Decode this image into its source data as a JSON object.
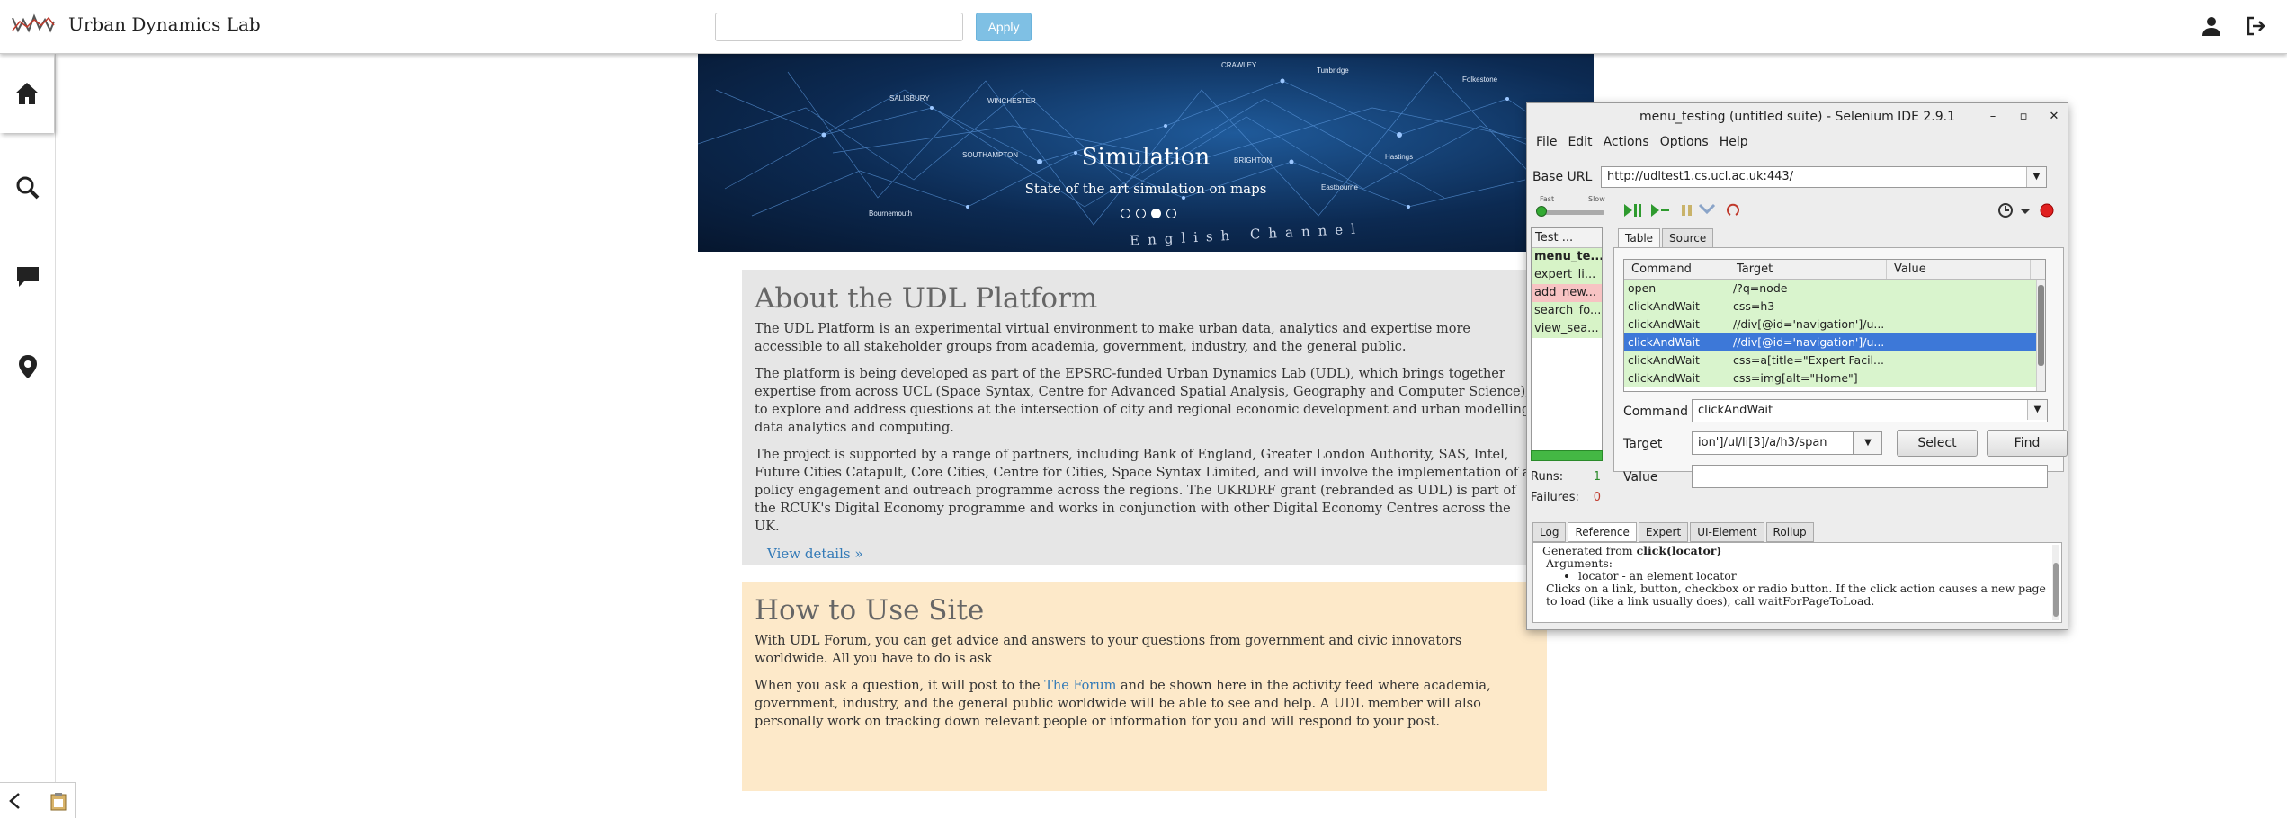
{
  "header": {
    "title": "Urban Dynamics Lab",
    "search_placeholder": "",
    "apply_label": "Apply"
  },
  "hero": {
    "title": "Simulation",
    "subtitle": "State of the art simulation on maps",
    "channel": "English Channel",
    "places": [
      "CRAWLEY",
      "Tunbridge",
      "SALISBURY",
      "WINCHESTER",
      "Folkestone",
      "SOUTHAMPTON",
      "BRIGHTON",
      "Hastings",
      "Bournemouth",
      "Eastbourne"
    ],
    "slides": 4,
    "active_slide": 3
  },
  "about": {
    "heading": "About the UDL Platform",
    "p1": "The UDL Platform is an experimental virtual environment to make urban data, analytics and expertise more accessible to all stakeholder groups from academia, government, industry, and the general public.",
    "p2": "The platform is being developed as part of the EPSRC-funded Urban Dynamics Lab (UDL), which brings together expertise from across UCL (Space Syntax, Centre for Advanced Spatial Analysis, Geography and Computer Science), to explore and address questions at the intersection of city and regional economic development and urban modelling, data analytics and computing.",
    "p3": "The project is supported by a range of partners, including Bank of England, Greater London Authority, SAS, Intel, Future Cities Catapult, Core Cities, Centre for Cities, Space Syntax Limited, and will involve the implementation of a policy engagement and outreach programme across the regions. The UKRDRF grant (rebranded as UDL) is part of the RCUK's Digital Economy programme and works in conjunction with other Digital Economy Centres across the UK.",
    "view_details": "View details »"
  },
  "howto": {
    "heading": "How to Use Site",
    "p1": "With UDL Forum, you can get advice and answers to your questions from government and civic innovators worldwide. All you have to do is ask",
    "p2_before": "When you ask a question, it will post to the ",
    "p2_link": "The Forum",
    "p2_after": " and be shown here in the activity feed where academia, government, industry, and the general public worldwide will be able to see and help. A UDL member will also personally work on tracking down relevant people or information for you and will respond to your post."
  },
  "selenium": {
    "title": "menu_testing (untitled suite) - Selenium IDE 2.9.1",
    "menu": [
      "File",
      "Edit",
      "Actions",
      "Options",
      "Help"
    ],
    "base_url_label": "Base URL",
    "base_url": "http://udltest1.cs.ucl.ac.uk:443/",
    "speed_fast": "Fast",
    "speed_slow": "Slow",
    "test_header": "Test ...",
    "test_cases": [
      {
        "name": "menu_te...",
        "status": "green",
        "bold": true
      },
      {
        "name": "expert_li...",
        "status": "green",
        "bold": false
      },
      {
        "name": "add_new...",
        "status": "red",
        "bold": false
      },
      {
        "name": "search_fo...",
        "status": "green",
        "bold": false
      },
      {
        "name": "view_sea...",
        "status": "green",
        "bold": false
      }
    ],
    "runs_label": "Runs:",
    "runs_value": "1",
    "failures_label": "Failures:",
    "failures_value": "0",
    "tabs": [
      "Table",
      "Source"
    ],
    "columns": [
      "Command",
      "Target",
      "Value"
    ],
    "rows": [
      {
        "command": "open",
        "target": "/?q=node",
        "value": ""
      },
      {
        "command": "clickAndWait",
        "target": "css=h3",
        "value": ""
      },
      {
        "command": "clickAndWait",
        "target": "//div[@id='navigation']/u...",
        "value": ""
      },
      {
        "command": "clickAndWait",
        "target": "//div[@id='navigation']/u...",
        "value": ""
      },
      {
        "command": "clickAndWait",
        "target": "css=a[title=\"Expert Facil...",
        "value": ""
      },
      {
        "command": "clickAndWait",
        "target": "css=img[alt=\"Home\"]",
        "value": ""
      }
    ],
    "selected_row": 3,
    "command_label": "Command",
    "command_value": "clickAndWait",
    "target_label": "Target",
    "target_value": "ion']/ul/li[3]/a/h3/span",
    "value_label": "Value",
    "value_value": "",
    "select_label": "Select",
    "find_label": "Find",
    "bottom_tabs": [
      "Log",
      "Reference",
      "Expert",
      "UI-Element",
      "Rollup"
    ],
    "ref_generated_prefix": "Generated from ",
    "ref_generated_fn": "click(locator)",
    "ref_arguments": "Arguments:",
    "ref_arg1": "locator - an element locator",
    "ref_desc": "Clicks on a link, button, checkbox or radio button. If the click action causes a new page to load (like a link usually does), call waitForPageToLoad."
  },
  "colors": {
    "apply": "#7fc0e4",
    "about_bg": "#e6e6e6",
    "howto_bg": "#fde9c9",
    "link": "#337ab7",
    "row_green": "#d9f4cd",
    "row_selected": "#3d78d8",
    "test_red": "#f7c3c3"
  }
}
